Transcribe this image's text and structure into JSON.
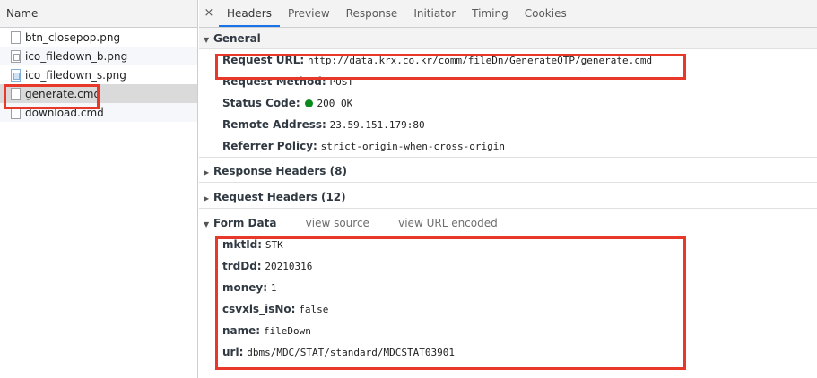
{
  "file_list": {
    "header": "Name",
    "files": [
      {
        "name": "btn_closepop.png",
        "icon": "file-icon"
      },
      {
        "name": "ico_filedown_b.png",
        "icon": "image-file-icon"
      },
      {
        "name": "ico_filedown_s.png",
        "icon": "image-file-icon"
      },
      {
        "name": "generate.cmd",
        "icon": "file-icon",
        "selected": true
      },
      {
        "name": "download.cmd",
        "icon": "file-icon"
      }
    ]
  },
  "tabs": {
    "close": "×",
    "items": [
      "Headers",
      "Preview",
      "Response",
      "Initiator",
      "Timing",
      "Cookies"
    ],
    "active": "Headers"
  },
  "general": {
    "title": "General",
    "request_url": {
      "key": "Request URL:",
      "value": "http://data.krx.co.kr/comm/fileDn/GenerateOTP/generate.cmd"
    },
    "request_method": {
      "key": "Request Method:",
      "value": "POST"
    },
    "status_code": {
      "key": "Status Code:",
      "value": "200 OK",
      "status_color": "#0a8b1e"
    },
    "remote_address": {
      "key": "Remote Address:",
      "value": "23.59.151.179:80"
    },
    "referrer_policy": {
      "key": "Referrer Policy:",
      "value": "strict-origin-when-cross-origin"
    }
  },
  "response_headers": {
    "title": "Response Headers (8)"
  },
  "request_headers": {
    "title": "Request Headers (12)"
  },
  "form_data": {
    "title": "Form Data",
    "view_source": "view source",
    "view_url_encoded": "view URL encoded",
    "fields": [
      {
        "key": "mktId:",
        "value": "STK"
      },
      {
        "key": "trdDd:",
        "value": "20210316"
      },
      {
        "key": "money:",
        "value": "1"
      },
      {
        "key": "csvxls_isNo:",
        "value": "false"
      },
      {
        "key": "name:",
        "value": "fileDown"
      },
      {
        "key": "url:",
        "value": "dbms/MDC/STAT/standard/MDCSTAT03901"
      }
    ]
  },
  "highlight_color": "#e8382a"
}
